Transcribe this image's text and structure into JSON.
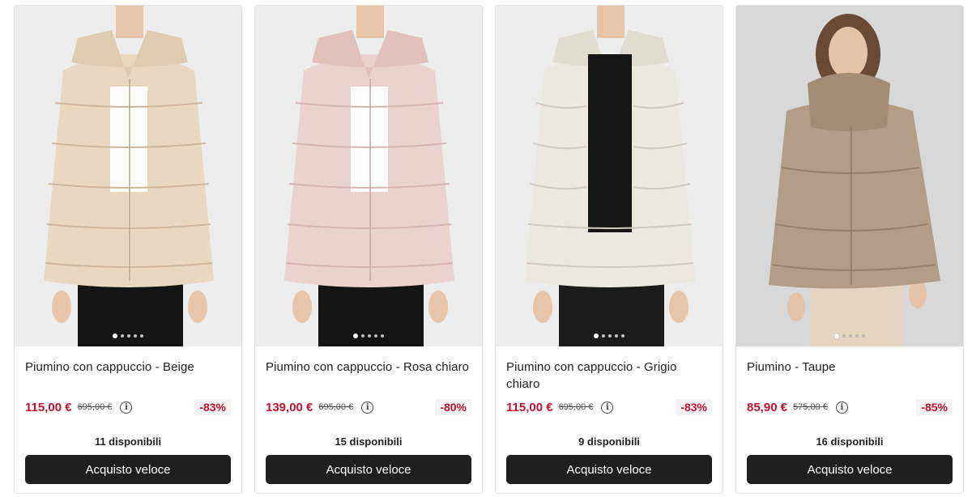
{
  "products": [
    {
      "title": "Piumino con cappuccio - Beige",
      "price": "115,00 €",
      "old_price": "695,00 €",
      "discount": "-83%",
      "stock": "11 disponibili",
      "button": "Acquisto veloce",
      "image_icon": "photo-carousel",
      "jacket_color": "#e9d8c0",
      "inner_color": "#ffffff"
    },
    {
      "title": "Piumino con cappuccio - Rosa chiaro",
      "price": "139,00 €",
      "old_price": "695,00 €",
      "discount": "-80%",
      "stock": "15 disponibili",
      "button": "Acquisto veloce",
      "image_icon": "photo-carousel",
      "jacket_color": "#ecd2cf",
      "inner_color": "#ffffff"
    },
    {
      "title": "Piumino con cappuccio - Grigio chiaro",
      "price": "115,00 €",
      "old_price": "695,00 €",
      "discount": "-83%",
      "stock": "9 disponibili",
      "button": "Acquisto veloce",
      "image_icon": "photo-carousel",
      "jacket_color": "#ebe8df",
      "inner_color": "#161616"
    },
    {
      "title": "Piumino - Taupe",
      "price": "85,90 €",
      "old_price": "575,00 €",
      "discount": "-85%",
      "stock": "16 disponibili",
      "button": "Acquisto veloce",
      "image_icon": "photo-carousel",
      "jacket_color": "#b49d86",
      "inner_color": "#a48c74"
    }
  ],
  "colors": {
    "price": "#c8102e",
    "button_bg": "#1f1f1f",
    "discount_bg": "#f3f3f3"
  }
}
